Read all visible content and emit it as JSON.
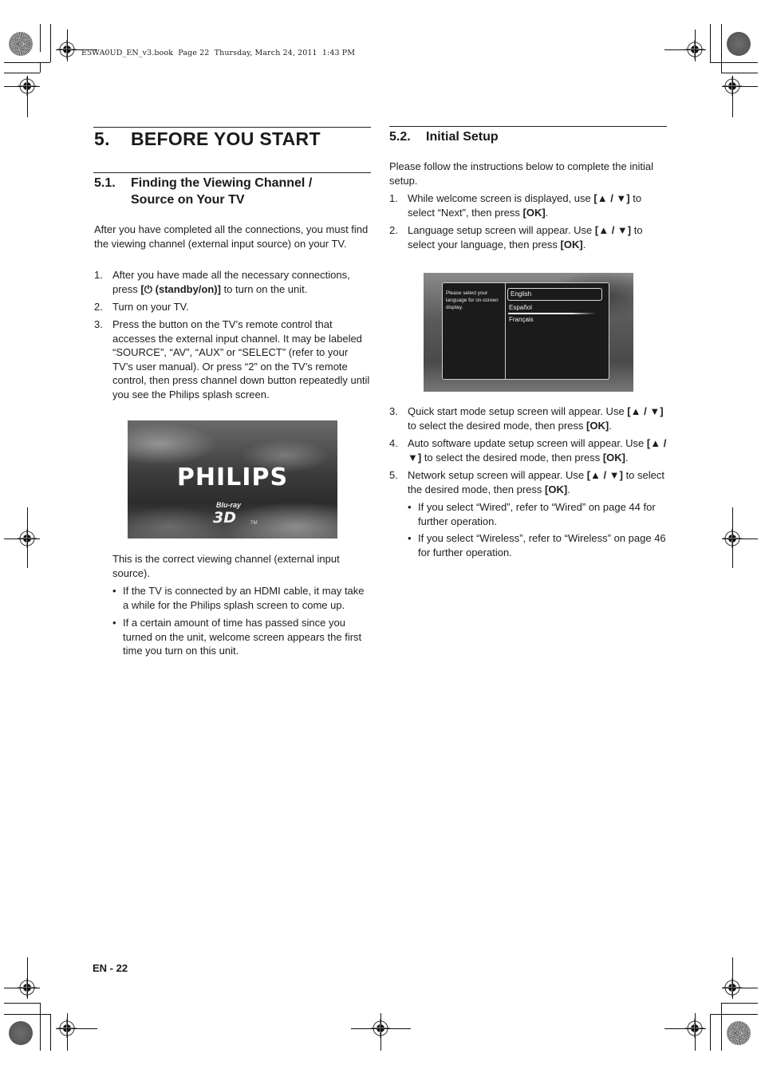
{
  "book_header": "E5WA0UD_EN_v3.book  Page 22  Thursday, March 24, 2011  1:43 PM",
  "chapter": {
    "number": "5.",
    "title": "BEFORE YOU START"
  },
  "section_5_1": {
    "number": "5.1.",
    "title_line1": "Finding the Viewing Channel /",
    "title_line2": "Source on Your TV",
    "intro": "After you have completed all the connections, you must find the viewing channel (external input source) on your TV.",
    "steps": [
      {
        "n": "1.",
        "pre": "After you have made all the necessary connections, press ",
        "bold": "[⏻ (standby/on)]",
        "post": " to turn on the unit."
      },
      {
        "n": "2.",
        "text": "Turn on your TV."
      },
      {
        "n": "3.",
        "text": "Press the button on the TV’s remote control that accesses the external input channel. It may be labeled “SOURCE”, “AV”, “AUX” or “SELECT” (refer to your TV’s user manual). Or press “2” on the TV’s remote control, then press channel down button repeatedly until you see the Philips splash screen."
      }
    ],
    "splash": {
      "brand": "PHILIPS",
      "bluray": "Blu-ray",
      "three_d": "3D",
      "tm": "TM"
    },
    "after_image": "This is the correct viewing channel (external input source).",
    "bullets": [
      "If the TV is connected by an HDMI cable, it may take a while for the Philips splash screen to come up.",
      "If a certain amount of time has passed since you turned on the unit, welcome screen appears the first time you turn on this unit."
    ]
  },
  "section_5_2": {
    "number": "5.2.",
    "title": "Initial Setup",
    "intro": "Please follow the instructions below to complete the initial setup.",
    "steps": [
      {
        "n": "1.",
        "pre": "While welcome screen is displayed, use ",
        "b1": "[▲ / ▼]",
        "mid": " to select “Next”, then press ",
        "b2": "[OK]",
        "post": "."
      },
      {
        "n": "2.",
        "pre": "Language setup screen will appear. Use ",
        "b1": "[▲ / ▼]",
        "mid": " to select your language, then press ",
        "b2": "[OK]",
        "post": "."
      },
      {
        "n": "3.",
        "pre": "Quick start mode setup screen will appear. Use ",
        "b1": "[▲ / ▼]",
        "mid": " to select the desired mode, then press ",
        "b2": "[OK]",
        "post": "."
      },
      {
        "n": "4.",
        "pre": " Auto software update setup screen will appear. Use ",
        "b1": "[▲ / ▼]",
        "mid": " to select the desired mode, then press ",
        "b2": "[OK]",
        "post": "."
      },
      {
        "n": "5.",
        "pre": "Network setup screen will appear. Use ",
        "b1": "[▲ / ▼]",
        "mid": " to select the desired mode, then press ",
        "b2": "[OK]",
        "post": "."
      }
    ],
    "language_screen": {
      "prompt": "Please select your language for on-screen display.",
      "options": [
        "English",
        "Español",
        "Français"
      ],
      "selected": "English"
    },
    "bullets": [
      "If you select “Wired”, refer to “Wired” on page 44 for further operation.",
      "If you select “Wireless”, refer to “Wireless” on page 46 for further operation."
    ]
  },
  "footer": {
    "page_label": "EN - 22"
  }
}
